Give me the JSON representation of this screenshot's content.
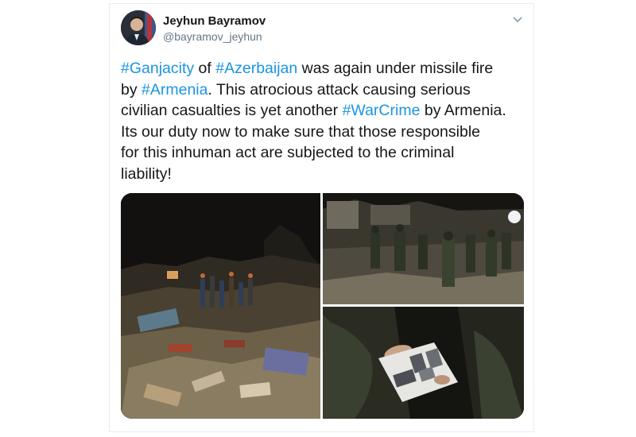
{
  "author": {
    "display_name": "Jeyhun Bayramov",
    "handle": "@bayramov_jeyhun",
    "avatar_icon": "profile-photo"
  },
  "menu_icon": "chevron-down-icon",
  "tweet": {
    "lines": [
      [
        {
          "text": "#Ganjacity",
          "tag": true
        },
        {
          "text": " of ",
          "tag": false
        },
        {
          "text": "#Azerbaijan",
          "tag": true
        },
        {
          "text": " was again under missile fire",
          "tag": false
        }
      ],
      [
        {
          "text": "by ",
          "tag": false
        },
        {
          "text": "#Armenia",
          "tag": true
        },
        {
          "text": ". This atrocious attack causing serious",
          "tag": false
        }
      ],
      [
        {
          "text": "civilian casualties is yet another ",
          "tag": false
        },
        {
          "text": "#WarCrime",
          "tag": true
        },
        {
          "text": " by Armenia.",
          "tag": false
        }
      ],
      [
        {
          "text": "Its our duty now to make sure that those responsible",
          "tag": false
        }
      ],
      [
        {
          "text": "for this inhuman act are subjected to the criminal",
          "tag": false
        }
      ],
      [
        {
          "text": "liability!",
          "tag": false
        }
      ]
    ]
  },
  "colors": {
    "hashtag": "#1b95e0",
    "text": "#14171a",
    "secondary": "#657786",
    "border": "#e6ecf0"
  },
  "photos": [
    {
      "icon": "rubble-night-photo"
    },
    {
      "icon": "rescuers-photo"
    },
    {
      "icon": "photo-album-photo"
    }
  ]
}
